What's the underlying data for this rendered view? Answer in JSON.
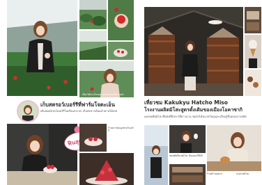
{
  "left_page": {
    "story_title": "เก็บสตรอว์เบอร์รีที่ฟาร์มโจตะเอ็น",
    "story_body": "เดินชมสตรอว์เบอร์รีในเรือนกระจก เก็บสดจากต้นแล้วทานได้เลย",
    "photo_caption": "เลือกได้ตามใจชอบ สตรอว์เบอร์รีหวานฉ่ำ",
    "sticker_text": "ฟินสุดๆ!!",
    "sub_caption": "ร้านคาเฟ่เมนูสตรอว์เบอร์รี"
  },
  "right_page": {
    "story_title_1": "เที่ยวชม Kakukyu Hatcho Miso",
    "story_title_2": "โรงงานผลิตมิโสะสูตรดั้งเดิมของเมืองโอคาซากิ",
    "story_body": "แหล่งผลิตมิโสะชื่อดังที่มีประวัติยาวนาน ชมถังไม้ขนาดใหญ่และเรียนรู้ขั้นตอนการผลิต",
    "photo_caption_1": "ซอฟต์ครีมรสมิโสะ ต้องลองให้ได้",
    "photo_caption_2": "ร้านค้าของฝาก",
    "photo_caption_3": "ขนมรสมิโสะ"
  },
  "colors": {
    "accent_pink": "#e38aa2",
    "greenhouse_green": "#3f7a3a",
    "barrel_brown": "#6b3b22"
  }
}
